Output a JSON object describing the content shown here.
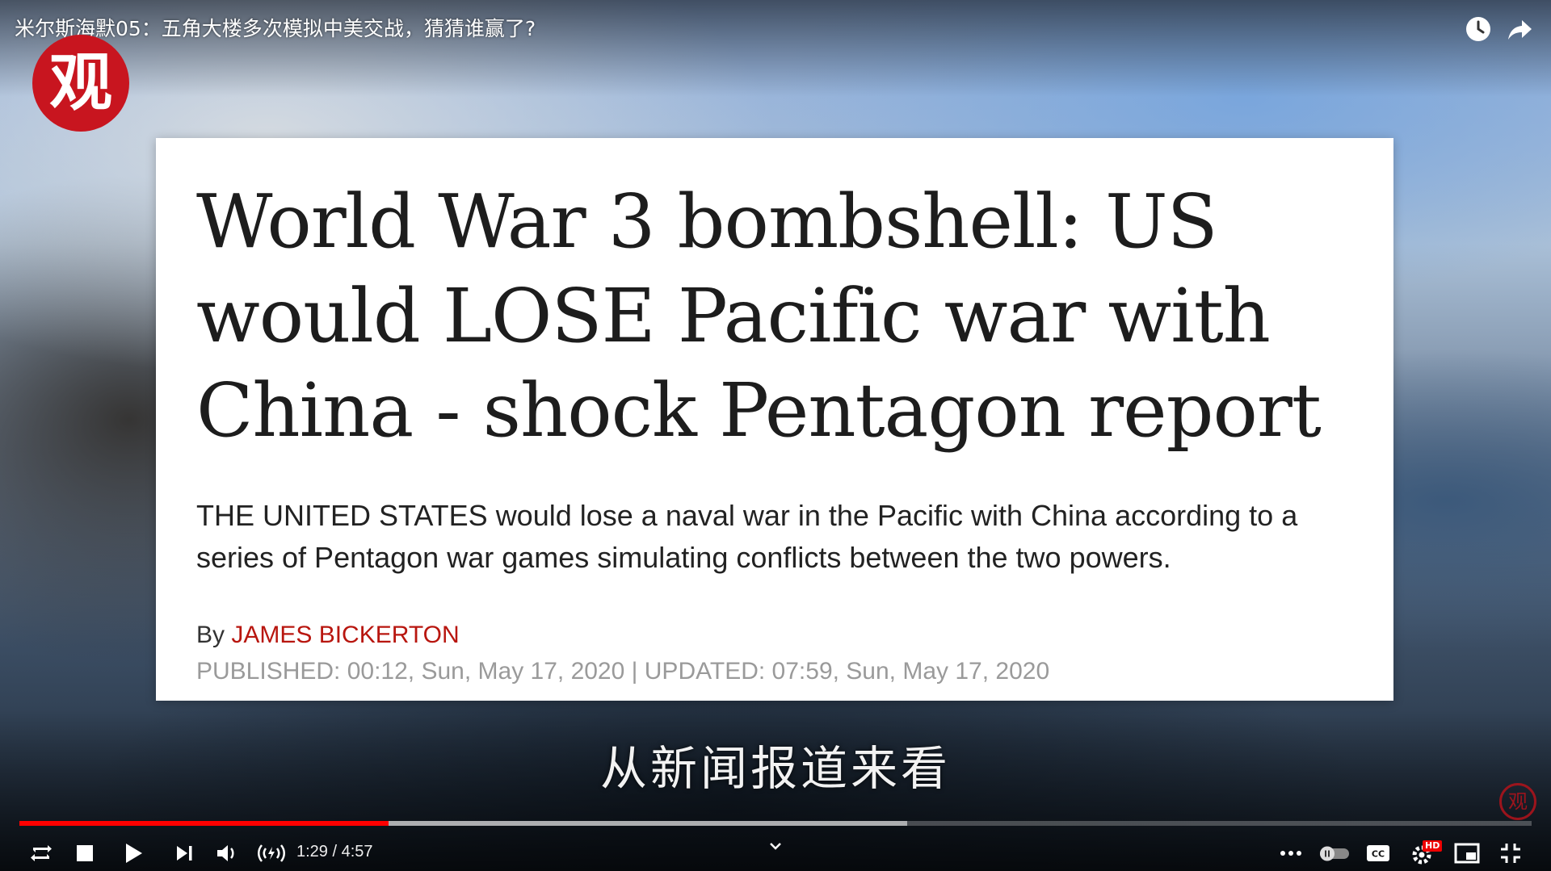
{
  "player": {
    "title": "米尔斯海默05：五角大楼多次模拟中美交战，猜猜谁赢了?",
    "channel_logo_glyph": "观",
    "top_icons": [
      "clock-icon",
      "share-icon"
    ],
    "subtitle": "从新闻报道来看",
    "watermark_glyph": "观",
    "progress": {
      "played_fraction": 0.244,
      "loaded_fraction": 0.587
    },
    "time": {
      "current": "1:29",
      "separator": " / ",
      "duration": "4:57"
    },
    "hd_label": "HD",
    "colors": {
      "progress_played": "#ff0000",
      "logo": "#c8151f",
      "author": "#b8160f"
    }
  },
  "article": {
    "headline": "World War 3 bombshell: US would LOSE Pacific war with China - shock Pentagon report",
    "summary": "THE UNITED STATES would lose a naval war in the Pacific with China according to a series of Pentagon war games simulating conflicts between the two powers.",
    "byline_prefix": "By ",
    "author": "JAMES BICKERTON",
    "dates": "PUBLISHED: 00:12, Sun, May 17, 2020 | UPDATED: 07:59, Sun, May 17, 2020"
  },
  "controls": {
    "left": [
      "loop-icon",
      "stop-icon",
      "play-icon",
      "next-icon",
      "volume-icon",
      "wireless-icon"
    ],
    "right": [
      "more-icon",
      "autoplay-toggle",
      "captions-icon",
      "settings-icon",
      "miniplayer-icon",
      "exit-fullscreen-icon"
    ]
  }
}
